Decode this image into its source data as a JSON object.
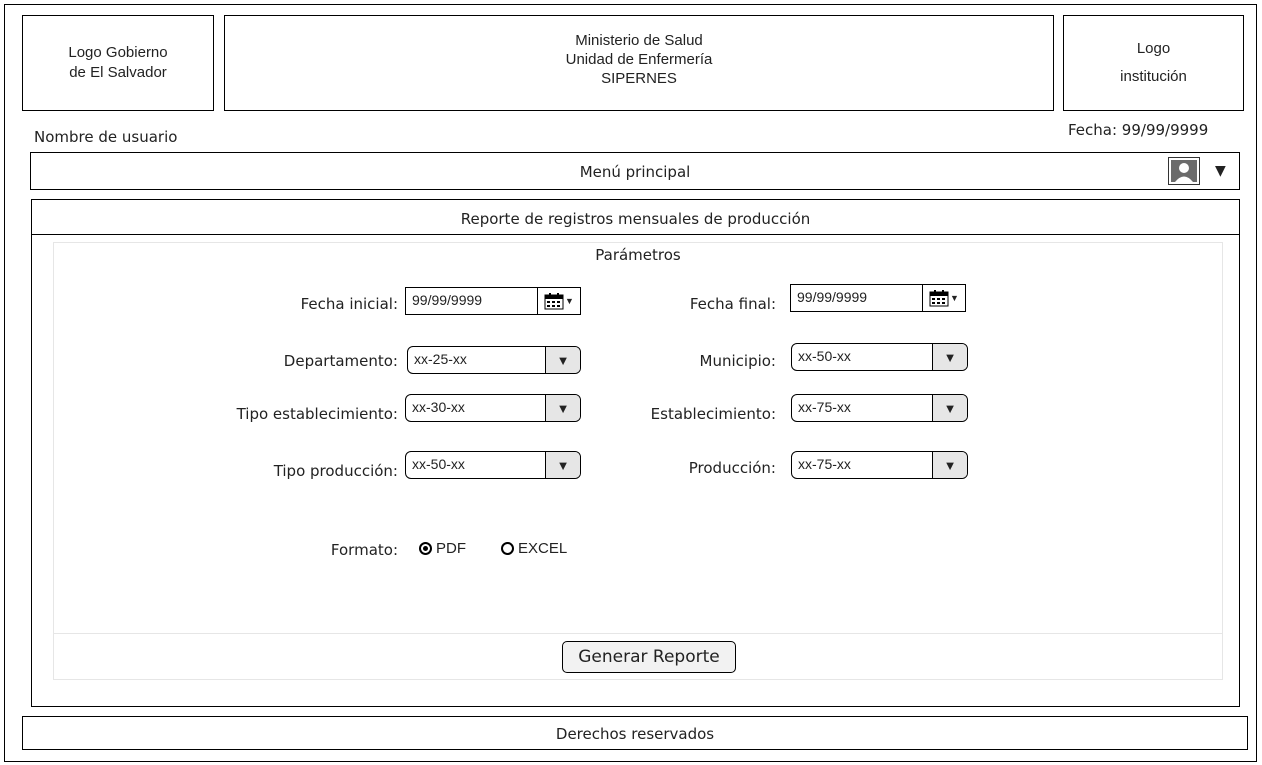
{
  "header": {
    "left_logo": {
      "line1": "Logo Gobierno",
      "line2": "de El Salvador"
    },
    "center": {
      "line1": "Ministerio de Salud",
      "line2": "Unidad de Enfermería",
      "line3": "SIPERNES"
    },
    "right_logo": {
      "line1": "Logo",
      "line2": "institución"
    }
  },
  "user": {
    "name": "Nombre de usuario",
    "date": "Fecha: 99/99/9999"
  },
  "menu": {
    "label": "Menú principal",
    "user_icon": "user-avatar-icon",
    "dropdown_icon": "caret-down-icon"
  },
  "report": {
    "title": "Reporte de registros mensuales de producción",
    "params_title": "Parámetros",
    "fecha_inicial": {
      "label": "Fecha inicial:",
      "value": "99/99/9999"
    },
    "fecha_final": {
      "label": "Fecha final:",
      "value": "99/99/9999"
    },
    "departamento": {
      "label": "Departamento:",
      "value": "xx-25-xx"
    },
    "municipio": {
      "label": "Municipio:",
      "value": "xx-50-xx"
    },
    "tipo_establecimiento": {
      "label": "Tipo establecimiento:",
      "value": "xx-30-xx"
    },
    "establecimiento": {
      "label": "Establecimiento:",
      "value": "xx-75-xx"
    },
    "tipo_produccion": {
      "label": "Tipo producción:",
      "value": "xx-50-xx"
    },
    "produccion": {
      "label": "Producción:",
      "value": "xx-75-xx"
    },
    "formato": {
      "label": "Formato:",
      "options": [
        "PDF",
        "EXCEL"
      ],
      "selected": "PDF"
    },
    "generate_button": "Generar Reporte"
  },
  "footer": {
    "label": "Derechos reservados"
  }
}
